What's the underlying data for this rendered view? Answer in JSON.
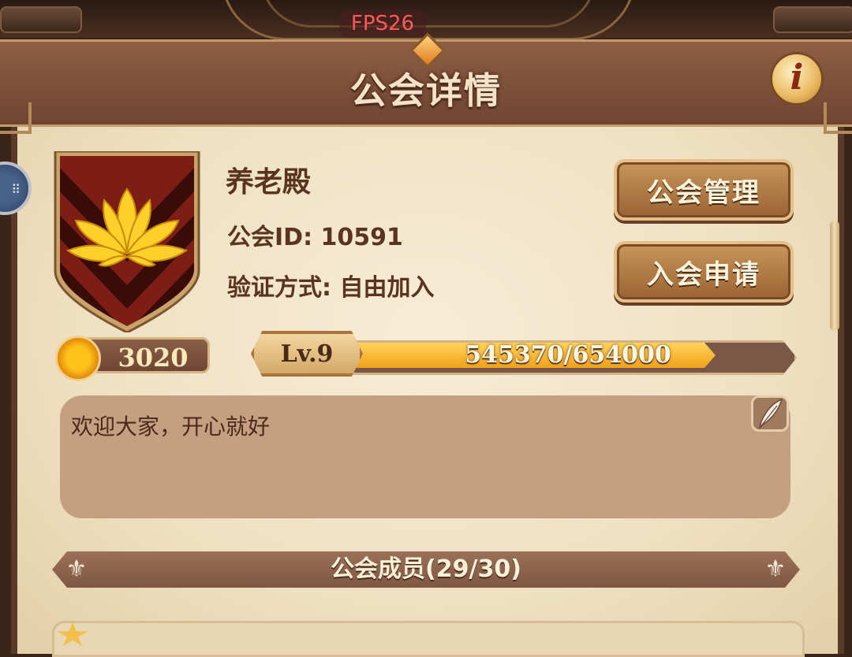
{
  "overlay": {
    "fps": "FPS26"
  },
  "header": {
    "title": "公会详情",
    "info_icon": "i"
  },
  "guild": {
    "name": "养老殿",
    "id_line": "公会ID: 10591",
    "join_line": "验证方式: 自由加入",
    "emblem_icon": "lotus-shield-icon",
    "coins": "3020",
    "level": "Lv.9",
    "xp_text": "545370/654000",
    "xp_progress": 0.834,
    "announcement": "欢迎大家，开心就好"
  },
  "buttons": {
    "manage": "公会管理",
    "applications": "入会申请"
  },
  "members": {
    "title": "公会成员(29/30)"
  },
  "colors": {
    "header_bg": "#8e5e45",
    "panel_bg": "#f3e6cc",
    "button_gold": "#c8955a",
    "xp_fill": "#f2a01a",
    "announcement_bg": "#c49f80"
  }
}
